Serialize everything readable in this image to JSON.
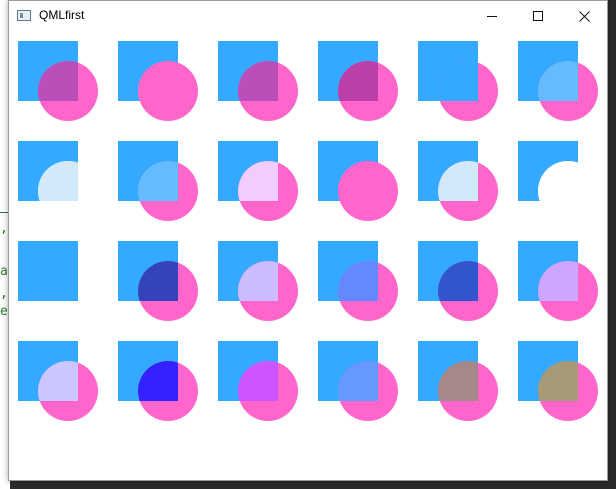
{
  "window": {
    "title": "QMLfirst"
  },
  "background_editor": {
    "glyphs": [
      ",",
      "a",
      ",",
      "e"
    ]
  },
  "title_buttons": {
    "minimize": "minimize-icon",
    "maximize": "maximize-icon",
    "close": "close-icon"
  },
  "colors": {
    "square": "#33aaff",
    "circle": "#ff66cc"
  },
  "grid": {
    "rows": 4,
    "columns": 6,
    "cells": [
      {
        "row": 0,
        "col": 0,
        "overlap": "#bb4fba",
        "circle": true
      },
      {
        "row": 0,
        "col": 1,
        "overlap": "#ff66cc",
        "circle": true
      },
      {
        "row": 0,
        "col": 2,
        "overlap": "#bb4fba",
        "circle": true
      },
      {
        "row": 0,
        "col": 3,
        "overlap": "#bb3fa8",
        "circle": true
      },
      {
        "row": 0,
        "col": 4,
        "overlap": "#33aaff",
        "circle": true
      },
      {
        "row": 0,
        "col": 5,
        "overlap": "#66bbff",
        "circle": true
      },
      {
        "row": 1,
        "col": 0,
        "overlap": "#d2e9fa",
        "circle": true,
        "circle_color": "#ffffff"
      },
      {
        "row": 1,
        "col": 1,
        "overlap": "#66bbff",
        "circle": true
      },
      {
        "row": 1,
        "col": 2,
        "overlap": "#f2ccff",
        "circle": true
      },
      {
        "row": 1,
        "col": 3,
        "overlap": "#ff66cc",
        "circle": true
      },
      {
        "row": 1,
        "col": 4,
        "overlap": "#d2e9fa",
        "circle": true
      },
      {
        "row": 1,
        "col": 5,
        "overlap": "#ffffff",
        "circle": true,
        "circle_color": "#ffffff"
      },
      {
        "row": 2,
        "col": 0,
        "overlap": "#33aaff",
        "circle": false
      },
      {
        "row": 2,
        "col": 1,
        "overlap": "#3344bb",
        "circle": true
      },
      {
        "row": 2,
        "col": 2,
        "overlap": "#ccbbff",
        "circle": true
      },
      {
        "row": 2,
        "col": 3,
        "overlap": "#6688ff",
        "circle": true
      },
      {
        "row": 2,
        "col": 4,
        "overlap": "#3355cc",
        "circle": true
      },
      {
        "row": 2,
        "col": 5,
        "overlap": "#cca6ff",
        "circle": true
      },
      {
        "row": 3,
        "col": 0,
        "overlap": "#ccc6ff",
        "circle": true
      },
      {
        "row": 3,
        "col": 1,
        "overlap": "#3322ff",
        "circle": true
      },
      {
        "row": 3,
        "col": 2,
        "overlap": "#cc55ff",
        "circle": true
      },
      {
        "row": 3,
        "col": 3,
        "overlap": "#6699ff",
        "circle": true
      },
      {
        "row": 3,
        "col": 4,
        "overlap": "#a68888",
        "circle": true
      },
      {
        "row": 3,
        "col": 5,
        "overlap": "#a69a77",
        "circle": true
      }
    ]
  }
}
